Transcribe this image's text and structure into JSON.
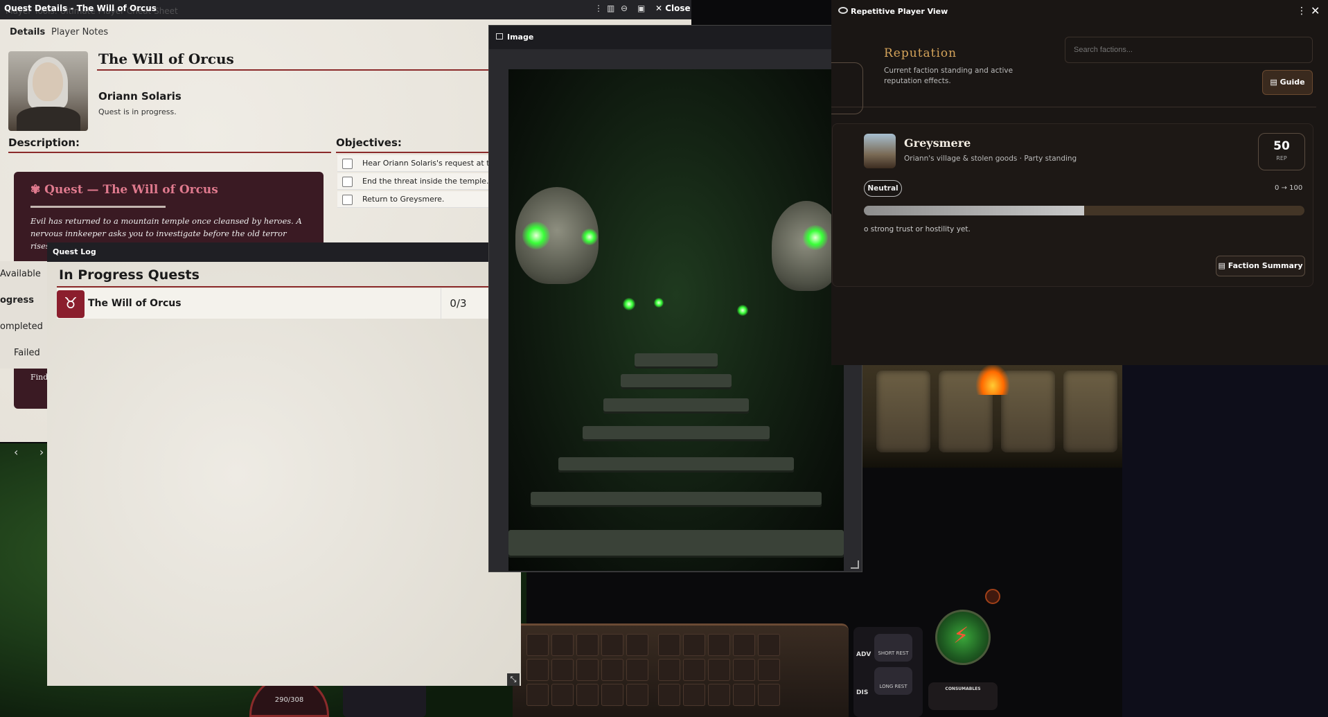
{
  "quest_window": {
    "title": "Quest Details - The Will of Orcus",
    "ghost_title": "Player Tools: Ultimate Player Cheat Sheet",
    "close_label": "Close",
    "tabs": [
      "Details",
      "Player Notes"
    ],
    "quest_name": "The Will of Orcus",
    "giver": "Oriann Solaris",
    "status": "Quest is in progress.",
    "description_label": "Description:",
    "objectives_label": "Objectives:",
    "card_heading": "Quest — The Will of Orcus",
    "card_body": "Evil has returned to a mountain temple once cleansed by heroes. A nervous innkeeper asks you to investigate before the old terror rises again.",
    "card_footer": "Find befo",
    "objectives": [
      "Hear Oriann Solaris's request at the",
      "End the threat inside the temple.",
      "Return to Greysmere."
    ],
    "pager_prev": "‹",
    "pager_next": "›"
  },
  "quest_log": {
    "title": "Quest Log",
    "sidebar": [
      "Available",
      "ogress",
      "ompleted",
      "Failed"
    ],
    "heading": "In Progress Quests",
    "quests": [
      {
        "name": "The Will of Orcus",
        "progress": "0/3"
      }
    ]
  },
  "image_window": {
    "title": "Image"
  },
  "reputation": {
    "window_title": "Repetitive Player View",
    "title": "Reputation",
    "subtitle": "Current faction standing and active reputation effects.",
    "search_placeholder": "Search factions...",
    "guide_label": "Guide",
    "faction": {
      "name": "Greysmere",
      "description": "Oriann's village & stolen goods · Party standing",
      "score": "50",
      "score_label": "REP",
      "standing": "Neutral",
      "range": "0 → 100",
      "progress": 0.5,
      "note": "o strong trust or hostility yet.",
      "summary_label": "Faction Summary"
    }
  },
  "hud": {
    "hp": "290/308",
    "adv": "ADV",
    "dis": "DIS",
    "short_rest": "SHORT REST",
    "long_rest": "LONG REST",
    "consumables": "CONSUMABLES"
  },
  "colors": {
    "accent_red": "#8b2a2a",
    "card_bg": "#3a1a23",
    "card_heading": "#e07a8e",
    "rep_gold": "#d4a35a"
  }
}
